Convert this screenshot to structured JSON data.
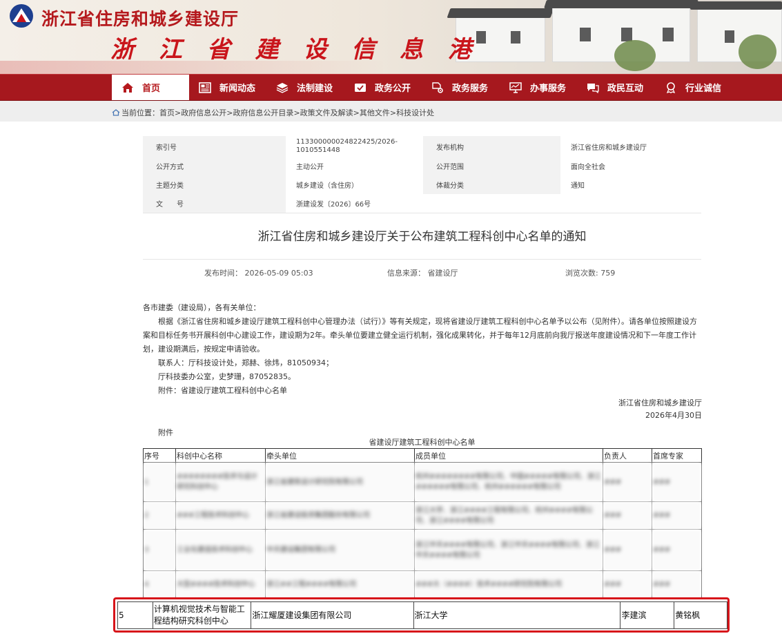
{
  "header": {
    "department": "浙江省住房和城乡建设厅",
    "portal_name": "浙 江 省 建 设 信 息 港"
  },
  "nav": {
    "items": [
      {
        "label": "首页",
        "icon": "home-icon"
      },
      {
        "label": "新闻动态",
        "icon": "newspaper-icon"
      },
      {
        "label": "法制建设",
        "icon": "layers-icon"
      },
      {
        "label": "政务公开",
        "icon": "mail-check-icon"
      },
      {
        "label": "政务服务",
        "icon": "document-gear-icon"
      },
      {
        "label": "办事服务",
        "icon": "monitor-icon"
      },
      {
        "label": "政民互动",
        "icon": "chat-icon"
      },
      {
        "label": "行业诚信",
        "icon": "medal-icon"
      }
    ]
  },
  "breadcrumb": {
    "prefix": "当前位置：",
    "items": [
      "首页",
      "政府信息公开",
      "政府信息公开目录",
      "政策文件及解读",
      "其他文件",
      "科技设计处"
    ],
    "separator": " > "
  },
  "meta": {
    "index_no_label": "索引号",
    "index_no": "113300000024822425/2026-1010551448",
    "publisher_label": "发布机构",
    "publisher": "浙江省住房和城乡建设厅",
    "open_mode_label": "公开方式",
    "open_mode": "主动公开",
    "open_scope_label": "公开范围",
    "open_scope": "面向全社会",
    "subject_label": "主题分类",
    "subject": "城乡建设（含住房）",
    "genre_label": "体裁分类",
    "genre": "通知",
    "doc_no_label": "文　　号",
    "doc_no": "浙建设发〔2026〕66号"
  },
  "document": {
    "title": "浙江省住房和城乡建设厅关于公布建筑工程科创中心名单的通知",
    "publish_time": "发布时间：  2026-05-09 05:03",
    "source": "信息来源：  省建设厅",
    "views": "浏览次数: 759",
    "salutation": "各市建委（建设局），各有关单位：",
    "paragraph": "根据《浙江省住房和城乡建设厅建筑工程科创中心管理办法（试行）》等有关规定，现将省建设厅建筑工程科创中心名单予以公布（见附件）。请各单位按照建设方案和目标任务书开展科创中心建设工作，建设期为2年。牵头单位要建立健全运行机制，强化成果转化，并于每年12月底前向我厅报送年度建设情况和下一年度工作计划，建设期满后，按规定申请验收。",
    "contact1": "联系人：厅科技设计处，郑赫、徐炜，81050934；",
    "contact2": "厅科技委办公室，史梦珊，87052835。",
    "attachment_ref": "附件：省建设厅建筑工程科创中心名单",
    "signature": "浙江省住房和城乡建设厅",
    "date": "2026年4月30日",
    "attachment_heading": "附件"
  },
  "table": {
    "title": "省建设厅建筑工程科创中心名单",
    "headers": [
      "序号",
      "科创中心名称",
      "牵头单位",
      "成员单位",
      "负责人",
      "首席专家"
    ],
    "blurred_rows": [
      [
        "1",
        "########技术与设计研究科创中心",
        "浙江省建筑设计研究院有限公司",
        "杭州########有限公司、中国#####有限公司、浙江######有限公司、杭州######有限公司",
        "###",
        "###"
      ],
      [
        "2",
        "###工程技术科创中心",
        "浙江省建设投资集团股份有限公司",
        "浙江大学、浙江####工程有限公司、杭州####有限公司、浙江####有限公司",
        "###",
        "###"
      ],
      [
        "3",
        "工业化建造技术科创中心",
        "中天建设集团有限公司",
        "浙江中天####有限公司、浙江中天####有限公司、浙江中天####有限公司",
        "###",
        "###"
      ],
      [
        "4",
        "大型####技术科创中心",
        "浙江##工程####有限公司",
        "###大（####）技术####研究院有限公司",
        "###",
        "###"
      ]
    ],
    "highlighted_row": {
      "no": "5",
      "name": "计算机视觉技术与智能工程结构研究科创中心",
      "lead": "浙江耀厦建设集团有限公司",
      "members": "浙江大学",
      "leader": "李建滨",
      "expert": "黄铭枫"
    }
  },
  "colors": {
    "nav_red": "#a6181e",
    "highlight_red": "#d7141a",
    "title_red": "#c9151b"
  }
}
